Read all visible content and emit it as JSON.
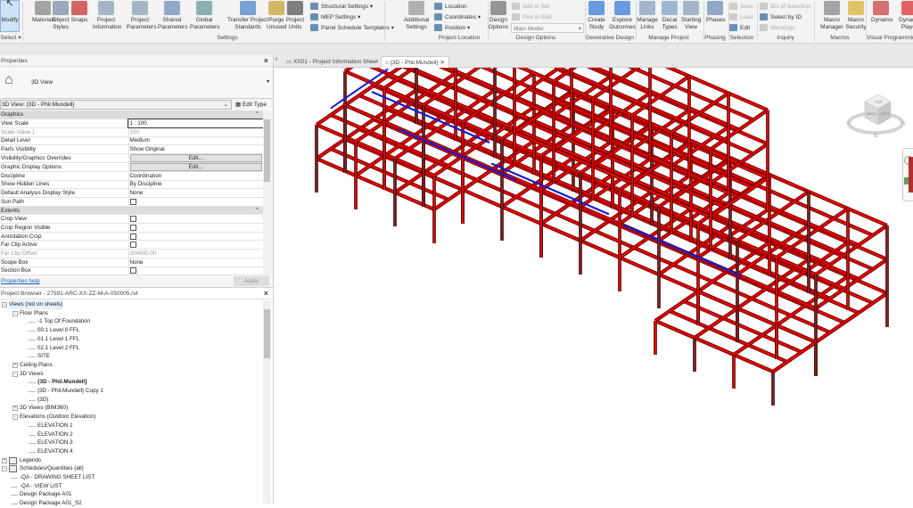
{
  "ribbon": {
    "buttons": [
      {
        "label": "Modify",
        "icon": "cursor-icon"
      },
      {
        "label": "Materials",
        "icon": "materials-icon"
      },
      {
        "label": "Object Styles",
        "icon": "object-styles-icon"
      },
      {
        "label": "Snaps",
        "icon": "magnet-icon"
      },
      {
        "label": "Project Information",
        "icon": "project-information-icon"
      },
      {
        "label": "Project Parameters",
        "icon": "project-parameters-icon"
      },
      {
        "label": "Shared Parameters",
        "icon": "shared-parameters-icon"
      },
      {
        "label": "Global Parameters",
        "icon": "global-parameters-icon"
      },
      {
        "label": "Transfer Project Standards",
        "icon": "transfer-icon"
      },
      {
        "label": "Purge Unused",
        "icon": "purge-icon"
      },
      {
        "label": "Project Units",
        "icon": "units-icon"
      },
      {
        "label": "Additional Settings",
        "icon": "wrench-icon"
      },
      {
        "label": "Design Options",
        "icon": "design-options-icon"
      },
      {
        "label": "Create Study",
        "icon": "create-study-icon"
      },
      {
        "label": "Explore Outcomes",
        "icon": "explore-outcomes-icon"
      },
      {
        "label": "Manage Links",
        "icon": "manage-links-icon"
      },
      {
        "label": "Decal Types",
        "icon": "decal-icon"
      },
      {
        "label": "Starting View",
        "icon": "starting-view-icon"
      },
      {
        "label": "Phases",
        "icon": "phases-icon"
      },
      {
        "label": "Macro Manager",
        "icon": "macro-manager-icon"
      },
      {
        "label": "Macro Security",
        "icon": "macro-security-icon"
      },
      {
        "label": "Dynamo",
        "icon": "dynamo-icon"
      },
      {
        "label": "Dynamo Player",
        "icon": "dynamo-player-icon"
      }
    ],
    "small": {
      "structural_settings": "Structural  Settings",
      "mep_settings": "MEP  Settings",
      "panel_schedule_templates": "Panel Schedule  Templates",
      "location": "Location",
      "coordinates": "Coordinates",
      "position": "Position",
      "add_to_set": "Add to Set",
      "pick_to_edit": "Pick to Edit",
      "main_model": "Main Model",
      "save": "Save",
      "load": "Load",
      "edit": "Edit",
      "ids_of_selection": "IDs of  Selection",
      "select_by_id": "Select  by ID",
      "warnings": "Warnings"
    },
    "panels": {
      "select": "Select",
      "settings": "Settings",
      "project_location": "Project Location",
      "design_options": "Design Options",
      "generative_design": "Generative Design",
      "manage_project": "Manage Project",
      "phasing": "Phasing",
      "selection": "Selection",
      "inquiry": "Inquiry",
      "macros": "Macros",
      "visual_programming": "Visual Programming"
    }
  },
  "properties": {
    "title": "Properties",
    "type": "3D View",
    "instance": "3D View: {3D - Phil.Mundell}",
    "edit_type": "Edit Type",
    "rows": [
      {
        "group": "Graphics"
      },
      {
        "k": "View Scale",
        "v": "1 : 100",
        "input": true
      },
      {
        "k": "Scale Value    1:",
        "v": "100",
        "gray": true
      },
      {
        "k": "Detail Level",
        "v": "Medium"
      },
      {
        "k": "Parts Visibility",
        "v": "Show Original"
      },
      {
        "k": "Visibility/Graphics Overrides",
        "v": "Edit...",
        "btn": true
      },
      {
        "k": "Graphic Display Options",
        "v": "Edit...",
        "btn": true
      },
      {
        "k": "Discipline",
        "v": "Coordination"
      },
      {
        "k": "Show Hidden Lines",
        "v": "By Discipline"
      },
      {
        "k": "Default Analysis Display Style",
        "v": "None"
      },
      {
        "k": "Sun Path",
        "cb": true
      },
      {
        "group": "Extents"
      },
      {
        "k": "Crop View",
        "cb": true
      },
      {
        "k": "Crop Region Visible",
        "cb": true
      },
      {
        "k": "Annotation Crop",
        "cb": true
      },
      {
        "k": "Far Clip Active",
        "cb": true
      },
      {
        "k": "Far Clip Offset",
        "v": "304800.00",
        "gray": true
      },
      {
        "k": "Scope Box",
        "v": "None"
      },
      {
        "k": "Section Box",
        "cb": true
      }
    ],
    "help": "Properties help",
    "apply": "Apply"
  },
  "browser": {
    "title": "Project Browser - 27591-ARC-XX-ZZ-M-A-050005.rvt",
    "items": [
      {
        "label": "Views (not on sheets)",
        "lvl": 0,
        "tg": "-",
        "sel": true
      },
      {
        "label": "Floor Plans",
        "lvl": 1,
        "tg": "-"
      },
      {
        "label": "-1 Top Of Foundation",
        "lvl": 2
      },
      {
        "label": "00.1 Level 0 FFL",
        "lvl": 2
      },
      {
        "label": "01.1 Level 1 FFL",
        "lvl": 2
      },
      {
        "label": "02.1 Level 2 FFL",
        "lvl": 2
      },
      {
        "label": "SITE",
        "lvl": 2
      },
      {
        "label": "Ceiling Plans",
        "lvl": 1,
        "tg": "+"
      },
      {
        "label": "3D Views",
        "lvl": 1,
        "tg": "-"
      },
      {
        "label": "{3D - Phil.Mundell}",
        "lvl": 2,
        "bold": true
      },
      {
        "label": "{3D - Phil.Mundell} Copy 1",
        "lvl": 2
      },
      {
        "label": "{3D}",
        "lvl": 2
      },
      {
        "label": "3D Views (BIM360)",
        "lvl": 1,
        "tg": "+"
      },
      {
        "label": "Elevations (Outdoor Elevation)",
        "lvl": 1,
        "tg": "-"
      },
      {
        "label": "ELEVATION 1",
        "lvl": 2
      },
      {
        "label": "ELEVATION 2",
        "lvl": 2
      },
      {
        "label": "ELEVATION 3",
        "lvl": 2
      },
      {
        "label": "ELEVATION 4",
        "lvl": 2
      },
      {
        "label": "Legends",
        "lvl": 0,
        "tg": "+",
        "icon": true
      },
      {
        "label": "Schedules/Quantities (all)",
        "lvl": 0,
        "tg": "-",
        "icon": true
      },
      {
        "label": "-QA - DRAWING SHEET LIST",
        "lvl": 1
      },
      {
        "label": "-QA - VIEW LIST",
        "lvl": 1
      },
      {
        "label": "Design Package A01",
        "lvl": 1
      },
      {
        "label": "Design Package A01_S2",
        "lvl": 1
      }
    ]
  },
  "tabs": [
    {
      "label": "XX01 - Project Information Sheet"
    },
    {
      "label": "{3D - Phil.Mundell}",
      "active": true
    }
  ],
  "viewcube": {
    "top": "TOP",
    "back": "BACK",
    "left": "LEFT",
    "north": "N",
    "east": "E",
    "west": "W"
  },
  "colors": {
    "steel": "#e10000",
    "duct": "#1a1ad0",
    "accent": "#1a5fb4"
  }
}
